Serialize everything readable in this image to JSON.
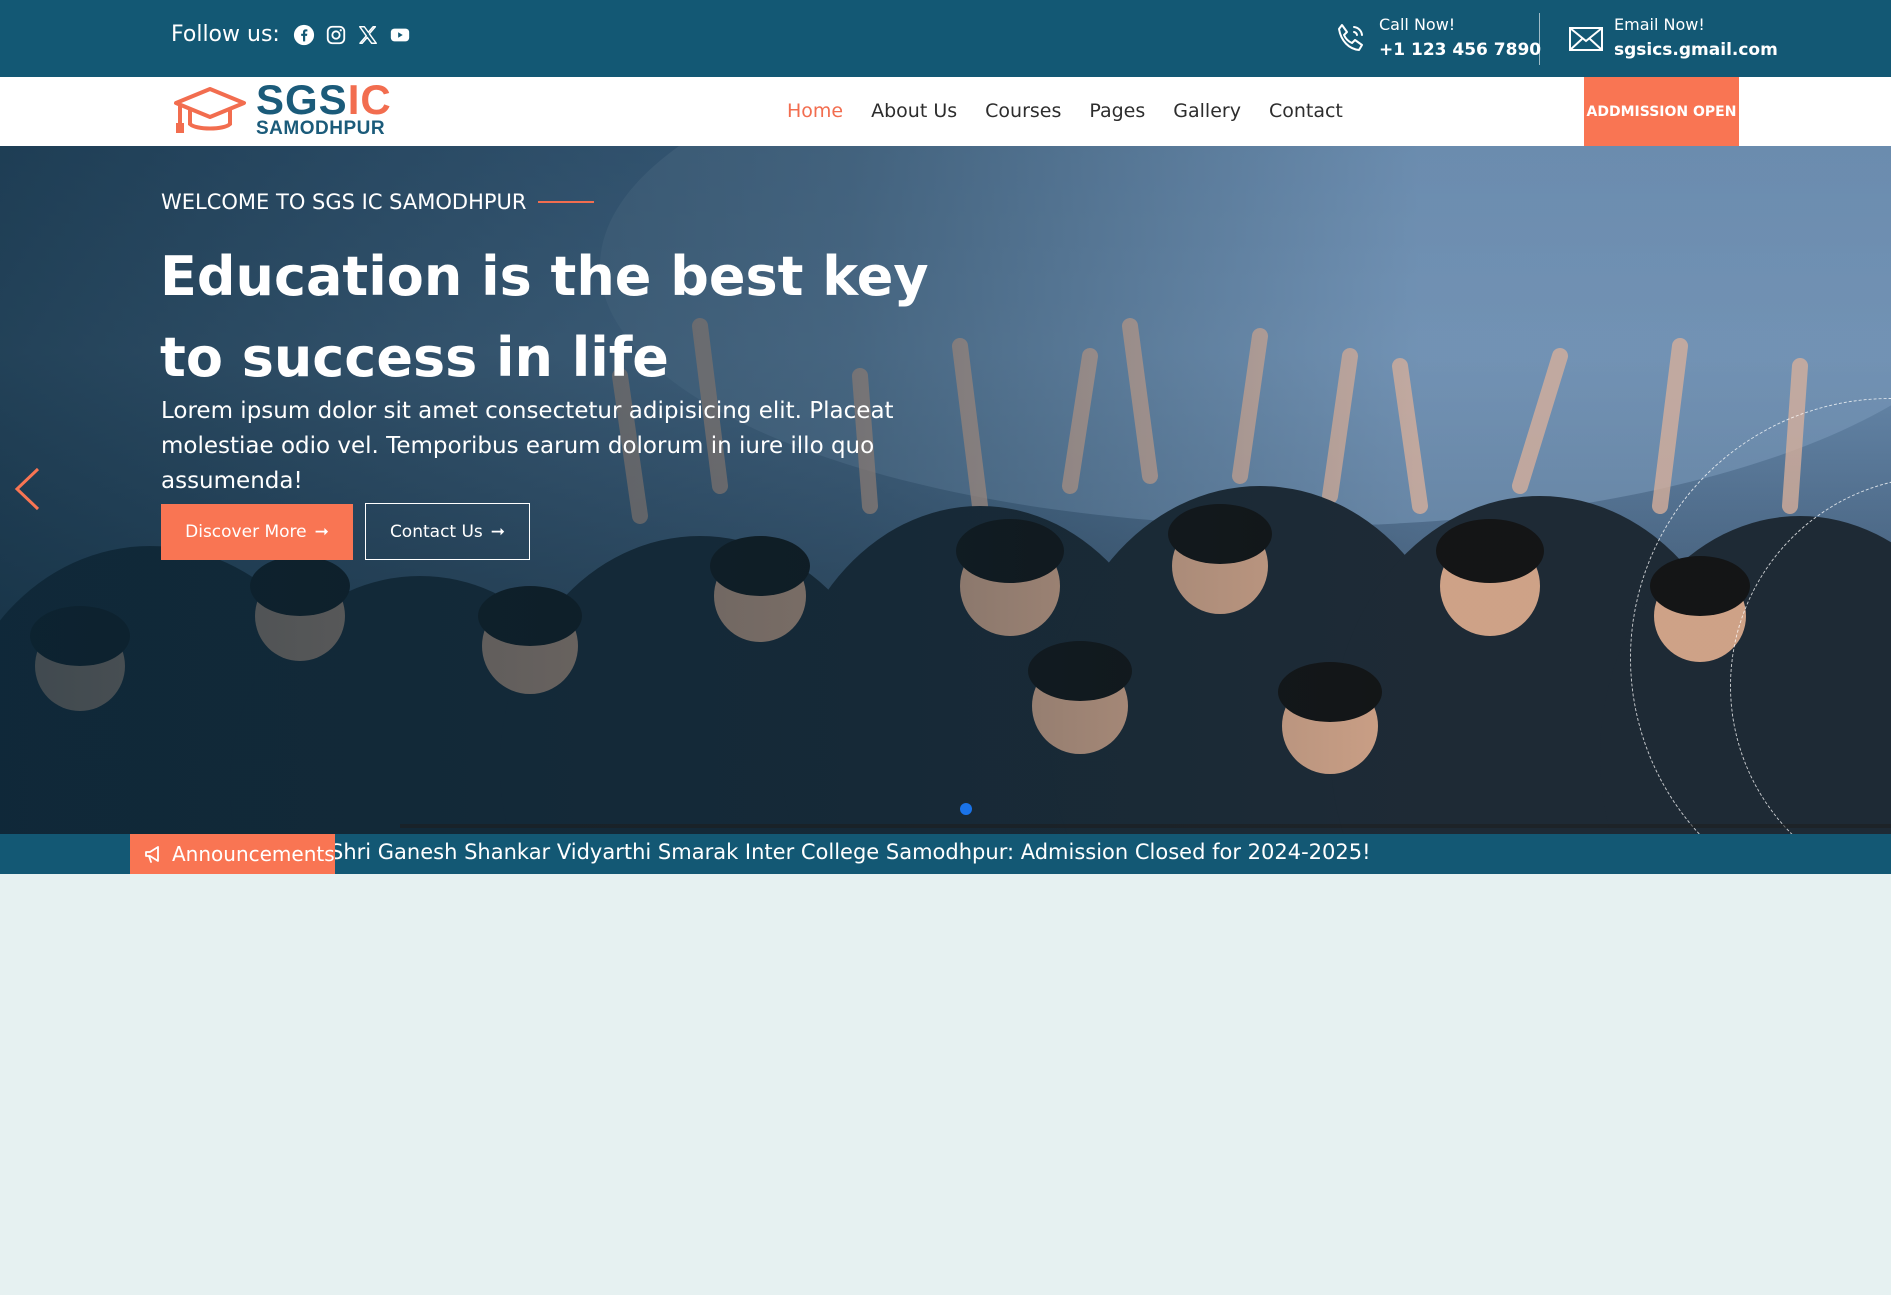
{
  "topbar": {
    "follow_label": "Follow us:",
    "social_icons": [
      "facebook-icon",
      "instagram-icon",
      "x-twitter-icon",
      "youtube-icon"
    ],
    "call_label": "Call Now!",
    "call_value": "+1 123 456 7890",
    "email_label": "Email Now!",
    "email_value": "sgsics.gmail.com"
  },
  "logo": {
    "main_left": "SGS",
    "main_right": "IC",
    "sub": "SAMODHPUR"
  },
  "nav": {
    "items": [
      {
        "label": "Home",
        "active": true
      },
      {
        "label": "About Us",
        "active": false
      },
      {
        "label": "Courses",
        "active": false
      },
      {
        "label": "Pages",
        "active": false
      },
      {
        "label": "Gallery",
        "active": false
      },
      {
        "label": "Contact",
        "active": false
      }
    ],
    "admission_label": "ADDMISSION OPEN"
  },
  "hero": {
    "eyebrow": "WELCOME TO SGS IC SAMODHPUR",
    "headline": "Education is the best key to success in life",
    "lede": "Lorem ipsum dolor sit amet consectetur adipisicing elit. Placeat molestiae odio vel. Temporibus earum dolorum in iure illo quo assumenda!",
    "discover_label": "Discover More",
    "contact_label": "Contact Us",
    "arrow_glyph": "➞",
    "slide_count": 1,
    "active_slide": 1
  },
  "announcement": {
    "label": "Announcements",
    "text": "Shri Ganesh Shankar Vidyarthi Smarak Inter College Samodhpur: Admission Closed for 2024-2025!"
  },
  "colors": {
    "primary": "#135874",
    "accent": "#f97553",
    "page_bg": "#e6f1f1"
  }
}
